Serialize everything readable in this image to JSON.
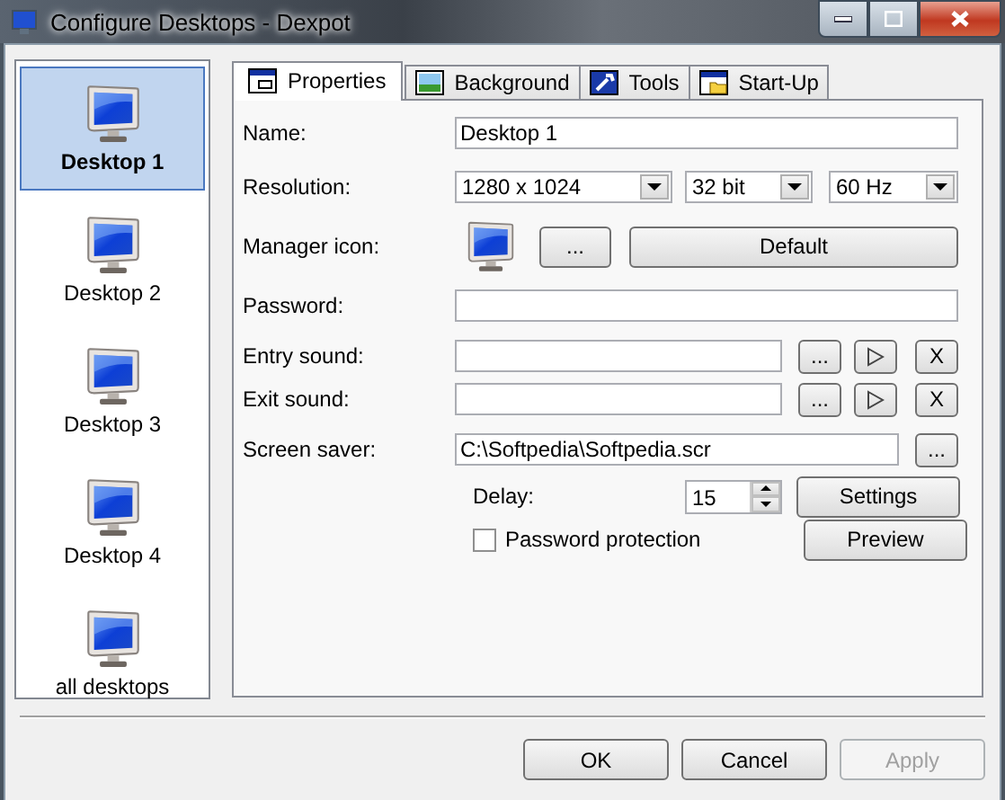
{
  "window": {
    "title": "Configure Desktops - Dexpot"
  },
  "desktops": [
    {
      "label": "Desktop 1",
      "selected": true
    },
    {
      "label": "Desktop 2",
      "selected": false
    },
    {
      "label": "Desktop 3",
      "selected": false
    },
    {
      "label": "Desktop 4",
      "selected": false
    },
    {
      "label": "all desktops",
      "selected": false
    }
  ],
  "tabs": [
    {
      "label": "Properties",
      "kind": "properties",
      "selected": true
    },
    {
      "label": "Background",
      "kind": "background",
      "selected": false
    },
    {
      "label": "Tools",
      "kind": "tools",
      "selected": false
    },
    {
      "label": "Start-Up",
      "kind": "startup",
      "selected": false
    }
  ],
  "properties": {
    "name": {
      "label": "Name:",
      "value": "Desktop 1"
    },
    "resolution": {
      "label": "Resolution:",
      "size": "1280 x 1024",
      "depth": "32 bit",
      "rate": "60 Hz"
    },
    "manager_icon": {
      "label": "Manager icon:",
      "browse": "...",
      "default": "Default"
    },
    "password": {
      "label": "Password:"
    },
    "entry_sound": {
      "label": "Entry sound:",
      "browse": "...",
      "clear": "X"
    },
    "exit_sound": {
      "label": "Exit sound:",
      "browse": "...",
      "clear": "X"
    },
    "screen_saver": {
      "label": "Screen saver:",
      "value": "C:\\Softpedia\\Softpedia.scr",
      "browse": "...",
      "delay_label": "Delay:",
      "delay": "15",
      "settings": "Settings",
      "password_protection": {
        "label": "Password protection",
        "checked": false
      },
      "preview": "Preview"
    }
  },
  "buttons": [
    {
      "label": "OK",
      "disabled": false
    },
    {
      "label": "Cancel",
      "disabled": false
    },
    {
      "label": "Apply",
      "disabled": true
    }
  ]
}
